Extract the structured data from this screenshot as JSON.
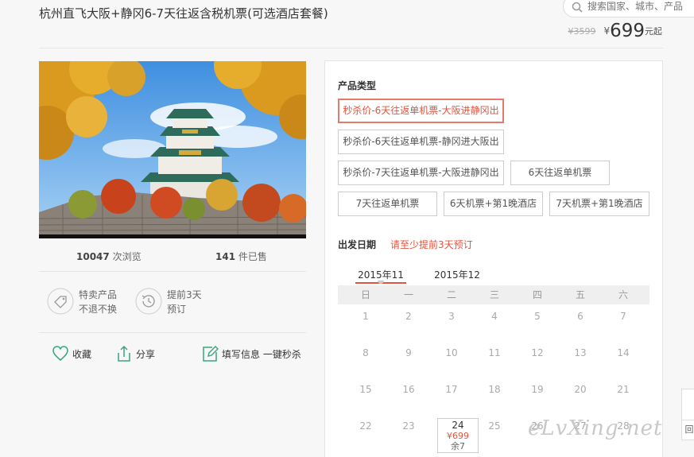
{
  "header": {
    "title": "杭州直飞大阪+静冈6-7天往返含税机票(可选酒店套餐)",
    "search_placeholder": "搜索国家、城市、产品"
  },
  "price": {
    "old": "¥3599",
    "currency": "¥",
    "current": "699",
    "unit": "元起"
  },
  "stats": {
    "views_count": "10047",
    "views_label": "次浏览",
    "sold_count": "141",
    "sold_label": "件已售"
  },
  "features": [
    {
      "icon": "tag-icon",
      "line1": "特卖产品",
      "line2": "不退不换"
    },
    {
      "icon": "clock-history-icon",
      "line1": "提前3天",
      "line2": "预订"
    }
  ],
  "actions": {
    "favorite": "收藏",
    "share": "分享",
    "fill_info": "填写信息 一键秒杀"
  },
  "product": {
    "label": "产品类型",
    "options": [
      "秒杀价-6天往返单机票-大阪进静冈出",
      "秒杀价-6天往返单机票-静冈进大阪出",
      "秒杀价-7天往返单机票-大阪进静冈出",
      "6天往返单机票",
      "7天往返单机票",
      "6天机票+第1晚酒店",
      "7天机票+第1晚酒店"
    ],
    "selected_index": 0
  },
  "departure": {
    "label": "出发日期",
    "hint": "请至少提前3天预订",
    "months": [
      "2015年11",
      "2015年12"
    ],
    "active_month": 0,
    "weekdays": [
      "日",
      "一",
      "二",
      "三",
      "四",
      "五",
      "六"
    ],
    "days": [
      "1",
      "2",
      "3",
      "4",
      "5",
      "6",
      "7",
      "8",
      "9",
      "10",
      "11",
      "12",
      "13",
      "14",
      "15",
      "16",
      "17",
      "18",
      "19",
      "20",
      "21",
      "22",
      "23",
      "24",
      "25",
      "26",
      "27",
      "28"
    ],
    "available": {
      "day": "24",
      "price": "¥699",
      "remain": "余7"
    }
  },
  "side": {
    "tab_label": "回"
  },
  "watermark": "eLvXing.net",
  "colors": {
    "accent": "#e2543e",
    "icon_green": "#3aa57c"
  }
}
